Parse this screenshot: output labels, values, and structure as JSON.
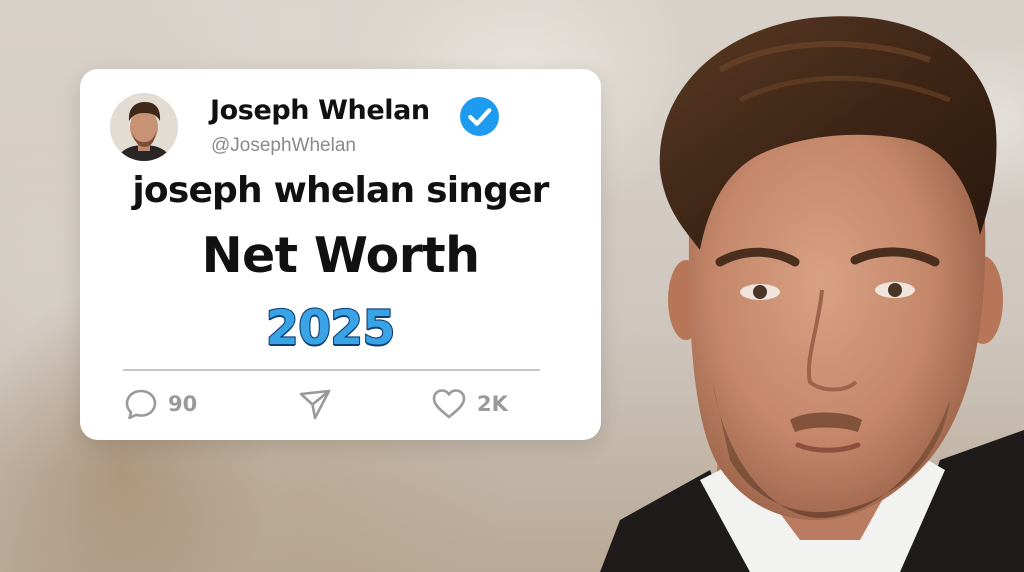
{
  "tweet": {
    "author_name": "Joseph Whelan",
    "handle": "@JosephWhelan",
    "verified": true,
    "headline_line1": "joseph whelan singer",
    "headline_line2": "Net Worth",
    "year": "2025",
    "replies": "90",
    "likes": "2K"
  },
  "icons": {
    "avatar": "avatar-photo",
    "verified": "verified-badge-icon",
    "reply": "comment-icon",
    "share": "send-icon",
    "like": "heart-icon"
  },
  "colors": {
    "card": "#ffffff",
    "verified_blue": "#1d9bf0",
    "year_fill": "#3aa3e6",
    "year_outline": "#0d3f73",
    "muted": "#9a9a9a"
  }
}
